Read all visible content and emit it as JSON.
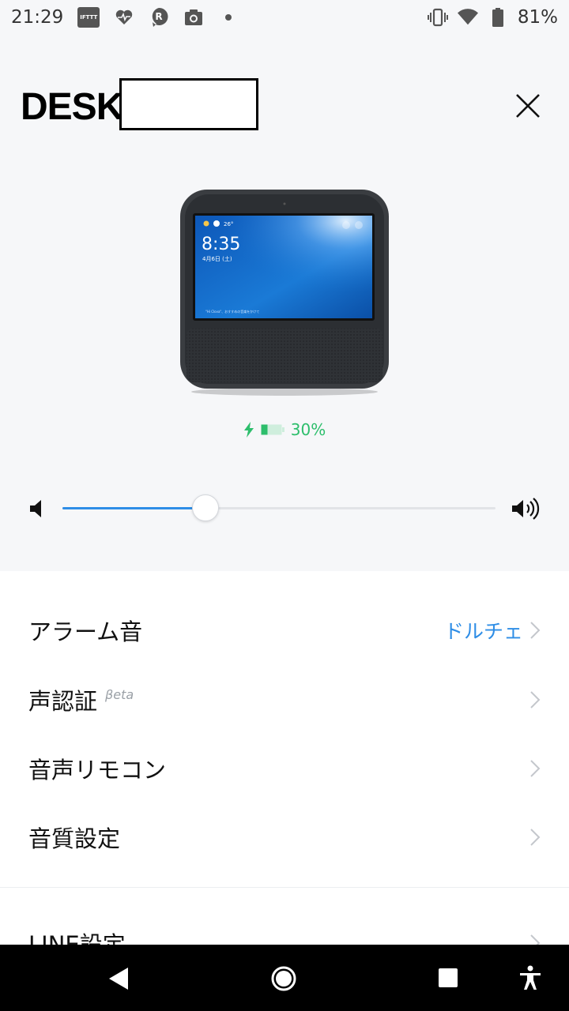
{
  "status_bar": {
    "time": "21:29",
    "battery_percent": "81%",
    "icons": [
      "ifttt-icon",
      "heart-pulse-icon",
      "r-badge-icon",
      "camera-icon",
      "dot-icon",
      "vibrate-icon",
      "wifi-icon",
      "battery-icon"
    ],
    "ifttt_text": "IFTTT"
  },
  "header": {
    "title": "DESK"
  },
  "device": {
    "battery_level": "30%",
    "charging": true,
    "screen_time": "8:35",
    "screen_date": "4月6日 (土)",
    "screen_temp": "26°",
    "screen_prompt": "\"Hi Clova\"、おすすめの音楽をかけて"
  },
  "volume": {
    "level_fraction": 0.33
  },
  "settings": {
    "items": [
      {
        "label": "アラーム音",
        "value": "ドルチェ"
      },
      {
        "label": "声認証",
        "tag": "βeta"
      },
      {
        "label": "音声リモコン"
      },
      {
        "label": "音質設定"
      },
      {
        "label": "LINE設定"
      }
    ]
  },
  "colors": {
    "accent": "#2e8de6",
    "battery_green": "#2dbe6c",
    "background": "#f6f7f9",
    "panel": "#ffffff"
  }
}
